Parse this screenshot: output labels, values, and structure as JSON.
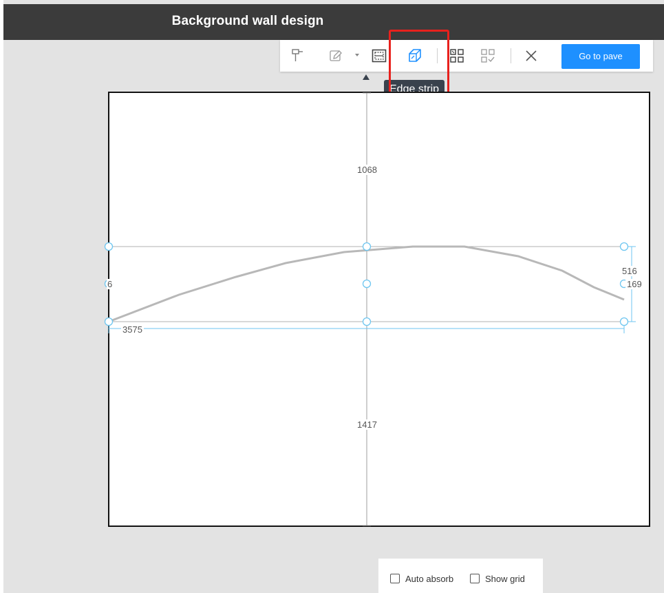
{
  "window": {
    "title": "Background wall design"
  },
  "toolbar": {
    "tools": [
      {
        "name": "brush-tool",
        "icon": "format-painter-icon"
      },
      {
        "name": "edit-tool",
        "icon": "edit-pencil-icon",
        "has_dropdown": true
      },
      {
        "name": "border-tool",
        "icon": "border-frame-icon"
      },
      {
        "name": "edge-strip-tool",
        "icon": "edge-strip-icon",
        "active": true
      },
      {
        "name": "merge-tool",
        "icon": "merge-grid-icon"
      },
      {
        "name": "select-grid-tool",
        "icon": "select-grid-icon"
      },
      {
        "name": "close-tool",
        "icon": "close-icon"
      }
    ],
    "primary_button": "Go to pave",
    "tooltip": "Edge strip"
  },
  "canvas": {
    "dimensions": {
      "top": "1068",
      "bottom": "1417",
      "width": "3575",
      "height": "516",
      "left_partial": "6",
      "right_partial": "169"
    }
  },
  "bottom": {
    "auto_absorb": {
      "label": "Auto absorb",
      "checked": false
    },
    "show_grid": {
      "label": "Show grid",
      "checked": false
    }
  },
  "colors": {
    "accent": "#1e90ff",
    "highlight": "#e8211d",
    "handle": "#6ec6f0",
    "curve": "#b8b8b8"
  }
}
